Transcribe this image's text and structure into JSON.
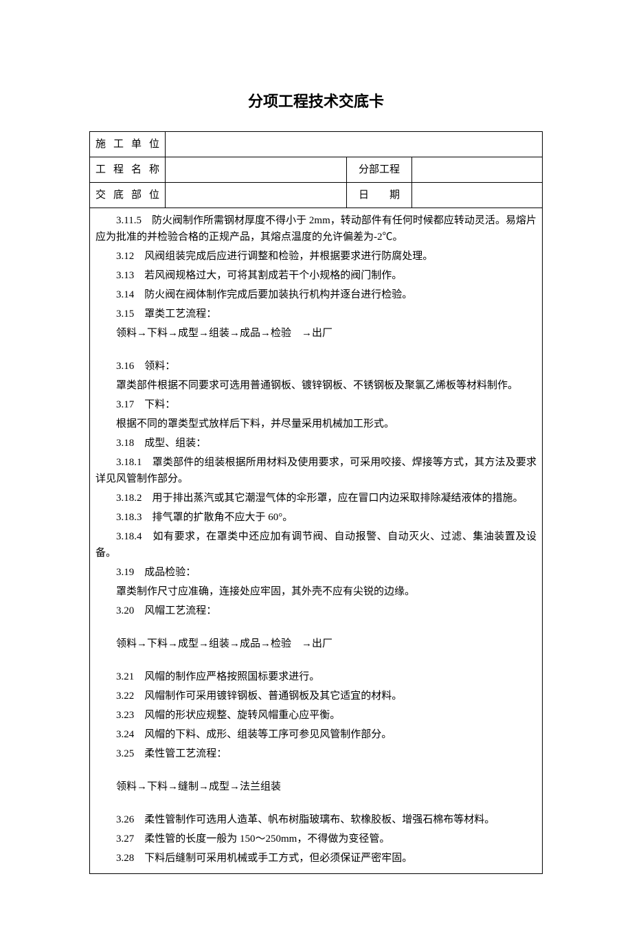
{
  "chart_data": {
    "type": "table",
    "title": "分项工程技术交底卡",
    "header_fields": {
      "施工单位": "",
      "工程名称": "",
      "分部工程": "",
      "交底部位": "",
      "日期": ""
    },
    "content_items": {
      "3.11.5": "防火阀制作所需钢材厚度不得小于 2mm，转动部件有任何时候都应转动灵活。易熔片应为批准的并检验合格的正规产品，其熔点温度的允许偏差为-2℃。",
      "3.12": "风阀组装完成后应进行调整和检验，并根据要求进行防腐处理。",
      "3.13": "若风阀规格过大，可将其割成若干个小规格的阀门制作。",
      "3.14": "防火阀在阀体制作完成后要加装执行机构并逐台进行检验。",
      "3.15": "罩类工艺流程：",
      "3.15_flow": "领料→下料→成型→组装→成品→检验　→出厂",
      "3.16": "领料：",
      "3.16_body": "罩类部件根据不同要求可选用普通钢板、镀锌钢板、不锈钢板及聚氯乙烯板等材料制作。",
      "3.17": "下料：",
      "3.17_body": "根据不同的罩类型式放样后下料，并尽量采用机械加工形式。",
      "3.18": "成型、组装：",
      "3.18.1": "罩类部件的组装根据所用材料及使用要求，可采用咬接、焊接等方式，其方法及要求详见风管制作部分。",
      "3.18.2": "用于排出蒸汽或其它潮湿气体的伞形罩，应在冒口内边采取排除凝结液体的措施。",
      "3.18.3": "排气罩的扩散角不应大于 60°。",
      "3.18.4": "如有要求，在罩类中还应加有调节阀、自动报警、自动灭火、过滤、集油装置及设备。",
      "3.19": "成品检验：",
      "3.19_body": "罩类制作尺寸应准确，连接处应牢固，其外壳不应有尖锐的边缘。",
      "3.20": "风帽工艺流程：",
      "3.20_flow": "领料→下料→成型→组装→成品→检验　→出厂",
      "3.21": "风帽的制作应严格按照国标要求进行。",
      "3.22": "风帽制作可采用镀锌钢板、普通钢板及其它适宜的材料。",
      "3.23": "风帽的形状应规整、旋转风帽重心应平衡。",
      "3.24": "风帽的下料、成形、组装等工序可参见风管制作部分。",
      "3.25": "柔性管工艺流程：",
      "3.25_flow": "领料→下料→缝制→成型→法兰组装",
      "3.26": "柔性管制作可选用人造革、帆布树脂玻璃布、软橡胶板、增强石棉布等材料。",
      "3.27": "柔性管的长度一般为 150～250mm，不得做为变径管。",
      "3.28": "下料后缝制可采用机械或手工方式，但必须保证严密牢固。"
    }
  },
  "title": "分项工程技术交底卡",
  "labels": {
    "unit": "施工单位",
    "project": "工程名称",
    "subproject": "分部工程",
    "section": "交底部位",
    "date": "日　　期"
  },
  "fields": {
    "unit": "",
    "project": "",
    "subproject": "",
    "section": "",
    "date": ""
  },
  "content": {
    "p1": "3.11.5　防火阀制作所需钢材厚度不得小于 2mm，转动部件有任何时候都应转动灵活。易熔片应为批准的并检验合格的正规产品，其熔点温度的允许偏差为-2℃。",
    "p2": "3.12　风阀组装完成后应进行调整和检验，并根据要求进行防腐处理。",
    "p3": "3.13　若风阀规格过大，可将其割成若干个小规格的阀门制作。",
    "p4": "3.14　防火阀在阀体制作完成后要加装执行机构并逐台进行检验。",
    "p5": "3.15　罩类工艺流程：",
    "p6": "领料→下料→成型→组装→成品→检验　→出厂",
    "p7": "3.16　领料：",
    "p8": "罩类部件根据不同要求可选用普通钢板、镀锌钢板、不锈钢板及聚氯乙烯板等材料制作。",
    "p9": "3.17　下料：",
    "p10": "根据不同的罩类型式放样后下料，并尽量采用机械加工形式。",
    "p11": "3.18　成型、组装：",
    "p12": "3.18.1　罩类部件的组装根据所用材料及使用要求，可采用咬接、焊接等方式，其方法及要求详见风管制作部分。",
    "p13": "3.18.2　用于排出蒸汽或其它潮湿气体的伞形罩，应在冒口内边采取排除凝结液体的措施。",
    "p14": "3.18.3　排气罩的扩散角不应大于 60°。",
    "p15": "3.18.4　如有要求，在罩类中还应加有调节阀、自动报警、自动灭火、过滤、集油装置及设备。",
    "p16": "3.19　成品检验：",
    "p17": "罩类制作尺寸应准确，连接处应牢固，其外壳不应有尖锐的边缘。",
    "p18": "3.20　风帽工艺流程：",
    "p19": "领料→下料→成型→组装→成品→检验　→出厂",
    "p20": "3.21　风帽的制作应严格按照国标要求进行。",
    "p21": "3.22　风帽制作可采用镀锌钢板、普通钢板及其它适宜的材料。",
    "p22": "3.23　风帽的形状应规整、旋转风帽重心应平衡。",
    "p23": "3.24　风帽的下料、成形、组装等工序可参见风管制作部分。",
    "p24": "3.25　柔性管工艺流程：",
    "p25": "领料→下料→缝制→成型→法兰组装",
    "p26": "3.26　柔性管制作可选用人造革、帆布树脂玻璃布、软橡胶板、增强石棉布等材料。",
    "p27": "3.27　柔性管的长度一般为 150～250mm，不得做为变径管。",
    "p28": "3.28　下料后缝制可采用机械或手工方式，但必须保证严密牢固。"
  }
}
